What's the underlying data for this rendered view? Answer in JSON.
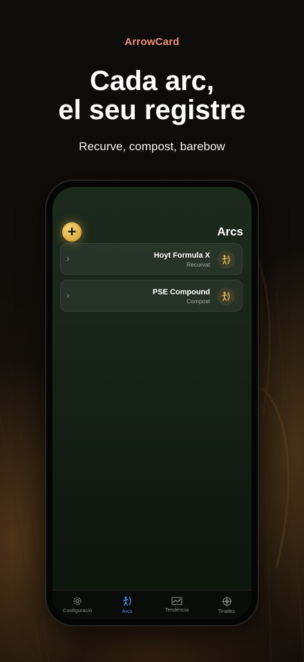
{
  "brand": "ArrowCard",
  "headline": {
    "line1": "Cada arc,",
    "line2": "el seu registre"
  },
  "subline": "Recurve, compost, barebow",
  "screen": {
    "title": "Arcs",
    "add_label": "+",
    "bows": [
      {
        "name": "Hoyt Formula X",
        "type": "Recurvat",
        "icon": "archer-icon"
      },
      {
        "name": "PSE Compound",
        "type": "Compost",
        "icon": "archer-icon"
      }
    ]
  },
  "tabs": [
    {
      "label": "Configuració",
      "icon": "gear-icon",
      "active": false
    },
    {
      "label": "Arcs",
      "icon": "archer-icon",
      "active": true
    },
    {
      "label": "Tendència",
      "icon": "chart-icon",
      "active": false
    },
    {
      "label": "Tirades",
      "icon": "target-icon",
      "active": false
    }
  ],
  "colors": {
    "brand": "#ef8f7e",
    "accent": "#4d8ef7",
    "gold": "#e2b452"
  }
}
